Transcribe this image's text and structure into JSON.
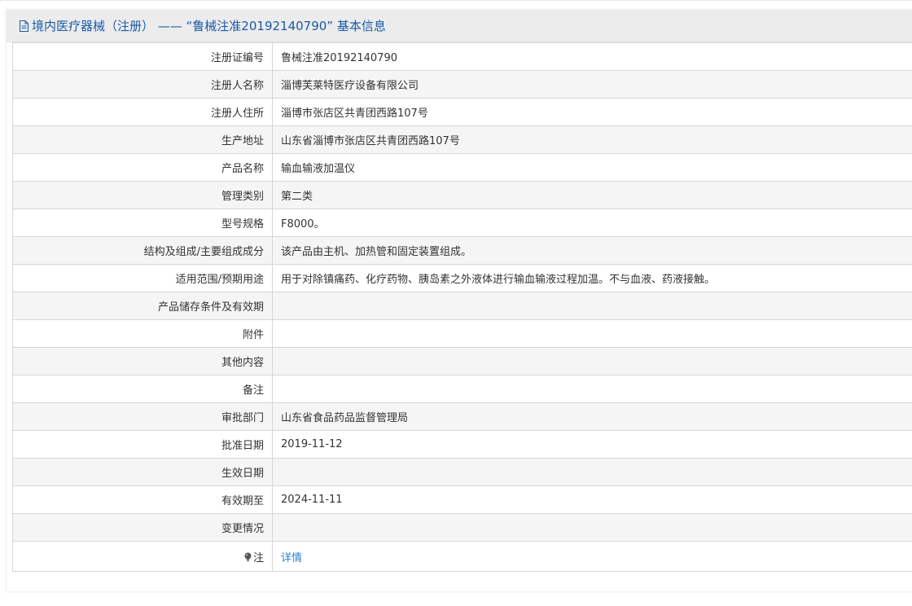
{
  "header": {
    "title": "境内医疗器械（注册） ——  “鲁械注准20192140790” 基本信息"
  },
  "rows": [
    {
      "label": "注册证编号",
      "value": "鲁械注准20192140790"
    },
    {
      "label": "注册人名称",
      "value": "淄博芙莱特医疗设备有限公司"
    },
    {
      "label": "注册人住所",
      "value": "淄博市张店区共青团西路107号"
    },
    {
      "label": "生产地址",
      "value": "山东省淄博市张店区共青团西路107号"
    },
    {
      "label": "产品名称",
      "value": "输血输液加温仪"
    },
    {
      "label": "管理类别",
      "value": "第二类"
    },
    {
      "label": "型号规格",
      "value": "F8000。"
    },
    {
      "label": "结构及组成/主要组成成分",
      "value": "该产品由主机、加热管和固定装置组成。"
    },
    {
      "label": "适用范围/预期用途",
      "value": "用于对除镇痛药、化疗药物、胰岛素之外液体进行输血输液过程加温。不与血液、药液接触。"
    },
    {
      "label": "产品储存条件及有效期",
      "value": ""
    },
    {
      "label": "附件",
      "value": ""
    },
    {
      "label": "其他内容",
      "value": ""
    },
    {
      "label": "备注",
      "value": ""
    },
    {
      "label": "审批部门",
      "value": "山东省食品药品监督管理局"
    },
    {
      "label": "批准日期",
      "value": "2019-11-12"
    },
    {
      "label": "生效日期",
      "value": ""
    },
    {
      "label": "有效期至",
      "value": "2024-11-11"
    },
    {
      "label": "变更情况",
      "value": ""
    }
  ],
  "note": {
    "label": "注",
    "icon": "lightbulb-icon",
    "link_text": "详情"
  },
  "colors": {
    "header_text": "#1a5aa8",
    "link": "#2a7fd6",
    "row_alt": "#f5f5f5"
  }
}
